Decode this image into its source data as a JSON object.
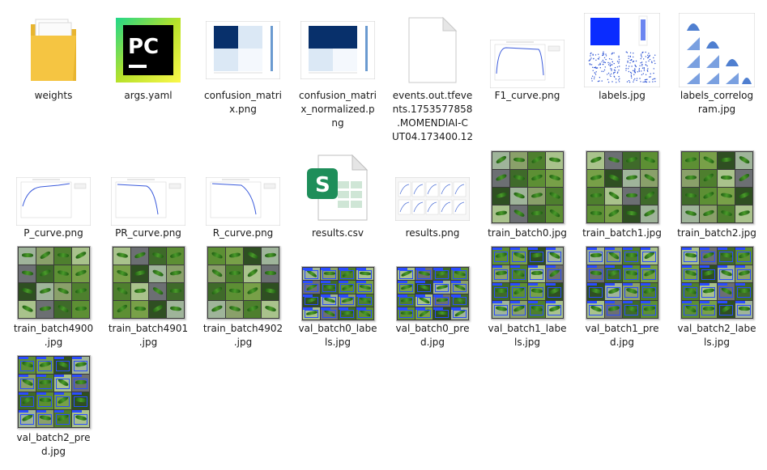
{
  "files": [
    {
      "name": "weights",
      "type": "folder"
    },
    {
      "name": "args.yaml",
      "type": "pycharm"
    },
    {
      "name": "confusion_matrix.png",
      "type": "matrix"
    },
    {
      "name": "confusion_matrix_normalized.png",
      "type": "matrix"
    },
    {
      "name": "events.out.tfevents.1753577858.MOMENDIAI-CUT04.173400.12",
      "type": "blank"
    },
    {
      "name": "F1_curve.png",
      "type": "curve-f1"
    },
    {
      "name": "labels.jpg",
      "type": "labels"
    },
    {
      "name": "labels_correlogram.jpg",
      "type": "correlogram"
    },
    {
      "name": "P_curve.png",
      "type": "curve-p"
    },
    {
      "name": "PR_curve.png",
      "type": "curve-pr"
    },
    {
      "name": "R_curve.png",
      "type": "curve-r"
    },
    {
      "name": "results.csv",
      "type": "csv"
    },
    {
      "name": "results.png",
      "type": "results"
    },
    {
      "name": "train_batch0.jpg",
      "type": "batch"
    },
    {
      "name": "train_batch1.jpg",
      "type": "batch"
    },
    {
      "name": "train_batch2.jpg",
      "type": "batch"
    },
    {
      "name": "train_batch4900.jpg",
      "type": "batch"
    },
    {
      "name": "train_batch4901.jpg",
      "type": "batch"
    },
    {
      "name": "train_batch4902.jpg",
      "type": "batch"
    },
    {
      "name": "val_batch0_labels.jpg",
      "type": "val-wide"
    },
    {
      "name": "val_batch0_pred.jpg",
      "type": "val-wide"
    },
    {
      "name": "val_batch1_labels.jpg",
      "type": "val"
    },
    {
      "name": "val_batch1_pred.jpg",
      "type": "val"
    },
    {
      "name": "val_batch2_labels.jpg",
      "type": "val"
    },
    {
      "name": "val_batch2_pred.jpg",
      "type": "val"
    }
  ],
  "icons": {
    "pycharm_text": "PC",
    "csv_letter": "S"
  },
  "colors": {
    "folder": "#f5c542",
    "pycharm_green": "#21d789",
    "matrix_blue": "#08306b",
    "csv_green": "#1e8e5a",
    "curve_blue": "#3b5bdb"
  }
}
